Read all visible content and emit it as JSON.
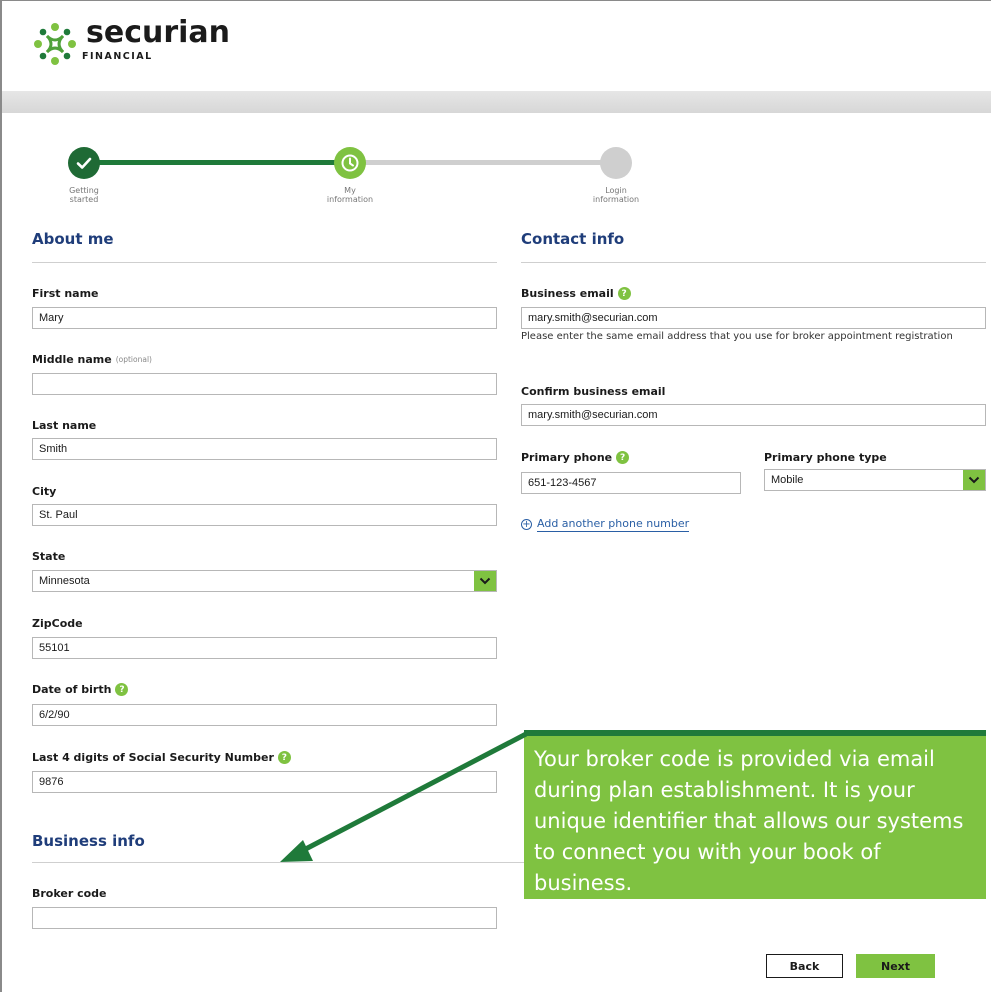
{
  "brand": {
    "name": "securian",
    "sub": "FINANCIAL",
    "accent": "#7fc241",
    "dark_green": "#1f7a3a",
    "heading_blue": "#1f3d7a"
  },
  "stepper": {
    "steps": [
      {
        "label_line1": "Getting",
        "label_line2": "started",
        "state": "complete",
        "icon": "check-icon"
      },
      {
        "label_line1": "My",
        "label_line2": "information",
        "state": "current",
        "icon": "clock-icon"
      },
      {
        "label_line1": "Login",
        "label_line2": "information",
        "state": "pending",
        "icon": ""
      }
    ]
  },
  "about_me": {
    "title": "About me",
    "first_name": {
      "label": "First name",
      "value": "Mary"
    },
    "middle_name": {
      "label": "Middle name",
      "optional": "(optional)",
      "value": ""
    },
    "last_name": {
      "label": "Last name",
      "value": "Smith"
    },
    "city": {
      "label": "City",
      "value": "St. Paul"
    },
    "state": {
      "label": "State",
      "value": "Minnesota"
    },
    "zipcode": {
      "label": "ZipCode",
      "value": "55101"
    },
    "dob": {
      "label": "Date of birth",
      "value": "6/2/90"
    },
    "ssn": {
      "label": "Last 4 digits of Social Security Number",
      "value": "9876"
    }
  },
  "business_info": {
    "title": "Business info",
    "broker_code": {
      "label": "Broker code",
      "value": ""
    }
  },
  "contact_info": {
    "title": "Contact info",
    "business_email": {
      "label": "Business email",
      "value": "mary.smith@securian.com",
      "help": "Please enter the same email address that you use for broker appointment registration"
    },
    "confirm_email": {
      "label": "Confirm business email",
      "value": "mary.smith@securian.com"
    },
    "primary_phone": {
      "label": "Primary phone",
      "value": "651-123-4567"
    },
    "phone_type": {
      "label": "Primary phone type",
      "value": "Mobile"
    },
    "add_phone": "Add another phone number"
  },
  "callout": {
    "text": "Your broker code is provided via email during plan establishment. It is your unique identifier that allows our systems to connect you with your book of business."
  },
  "buttons": {
    "back": "Back",
    "next": "Next"
  }
}
